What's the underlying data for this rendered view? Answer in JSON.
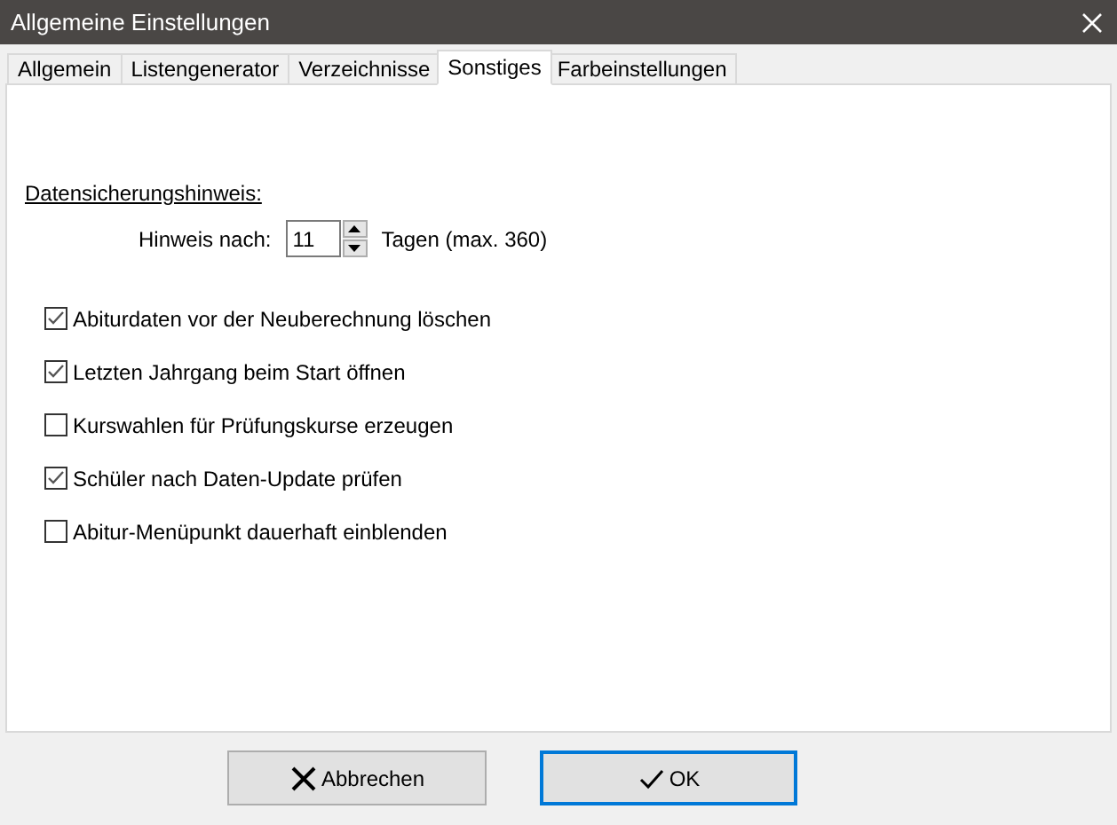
{
  "window": {
    "title": "Allgemeine Einstellungen"
  },
  "tabs": [
    {
      "label": "Allgemein",
      "selected": false
    },
    {
      "label": "Listengenerator",
      "selected": false
    },
    {
      "label": "Verzeichnisse",
      "selected": false
    },
    {
      "label": "Sonstiges",
      "selected": true
    },
    {
      "label": "Farbeinstellungen",
      "selected": false
    }
  ],
  "backup_notice": {
    "heading": "Datensicherungshinweis:",
    "label": "Hinweis nach:",
    "value": "11",
    "unit": "Tagen (max. 360)"
  },
  "options": [
    {
      "label": "Abiturdaten vor der Neuberechnung löschen",
      "checked": true
    },
    {
      "label": "Letzten Jahrgang beim Start öffnen",
      "checked": true
    },
    {
      "label": "Kurswahlen für Prüfungskurse erzeugen",
      "checked": false
    },
    {
      "label": "Schüler nach Daten-Update prüfen",
      "checked": true
    },
    {
      "label": "Abitur-Menüpunkt dauerhaft einblenden",
      "checked": false
    }
  ],
  "buttons": [
    {
      "label": "Abbrechen",
      "kind": "cancel",
      "default": false
    },
    {
      "label": "OK",
      "kind": "ok",
      "default": true
    }
  ]
}
